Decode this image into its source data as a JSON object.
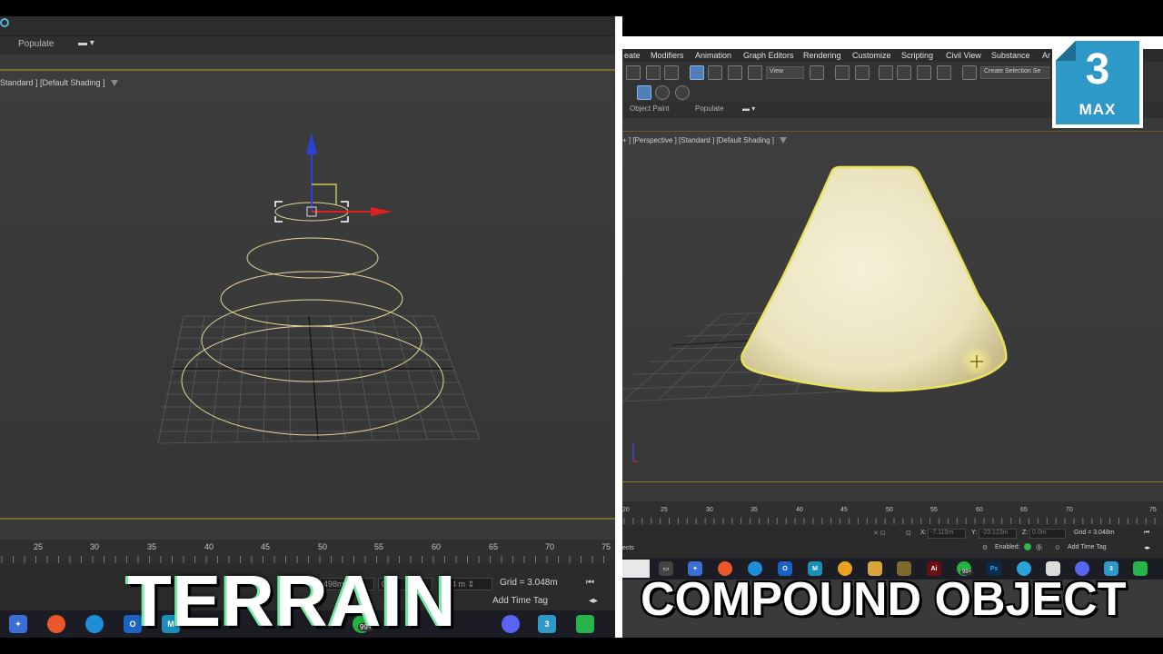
{
  "left_window": {
    "ribbon": {
      "populate_label": "Populate"
    },
    "viewport": {
      "label": "Standard ] [Default Shading ]"
    },
    "timeline": {
      "ticks": [
        "25",
        "30",
        "35",
        "40",
        "45",
        "50",
        "55",
        "60",
        "65",
        "70",
        "75"
      ]
    },
    "status": {
      "field_a": "498m",
      "field_b": "0.28",
      "field_c": "24",
      "field_c_unit": "m",
      "grid": "Grid = 3.048m",
      "time_tag": "Add Time Tag"
    }
  },
  "right_window": {
    "menu": [
      "eate",
      "Modifiers",
      "Animation",
      "Graph Editors",
      "Rendering",
      "Customize",
      "Scripting",
      "Civil View",
      "Substance",
      "Ar"
    ],
    "toolbar": {
      "view_select": "View",
      "selection_set": "Create Selection Se"
    },
    "ribbon": {
      "object_paint": "Object Paint",
      "populate": "Populate"
    },
    "viewport": {
      "label": "+ ] [Perspective ] [Standard ] [Default Shading ]"
    },
    "timeline": {
      "ticks": [
        "20",
        "25",
        "30",
        "35",
        "40",
        "45",
        "50",
        "55",
        "60",
        "65",
        "70",
        "75"
      ]
    },
    "status": {
      "x_label": "X:",
      "x_value": "-7.119m",
      "y_label": "Y:",
      "y_value": "-23.123m",
      "z_label": "Z:",
      "z_value": "0.0m",
      "grid": "Grid = 3.048m",
      "enabled": "Enabled:",
      "time_tag": "Add Time Tag",
      "objects": "ects"
    }
  },
  "logo": {
    "number": "3",
    "text": "MAX"
  },
  "captions": {
    "left": "TERRAIN",
    "right": "COMPOUND OBJECT"
  },
  "taskbar_badges": {
    "left_whatsapp": "99+",
    "right_whatsapp": "99+"
  },
  "colors": {
    "selection_yellow": "#e8e35a",
    "spline_color": "#e4d89a",
    "cone_color": "#f1ebcb",
    "logo_blue": "#2e98c7",
    "axis_blue": "#2c3fd8",
    "axis_red": "#e02020"
  }
}
